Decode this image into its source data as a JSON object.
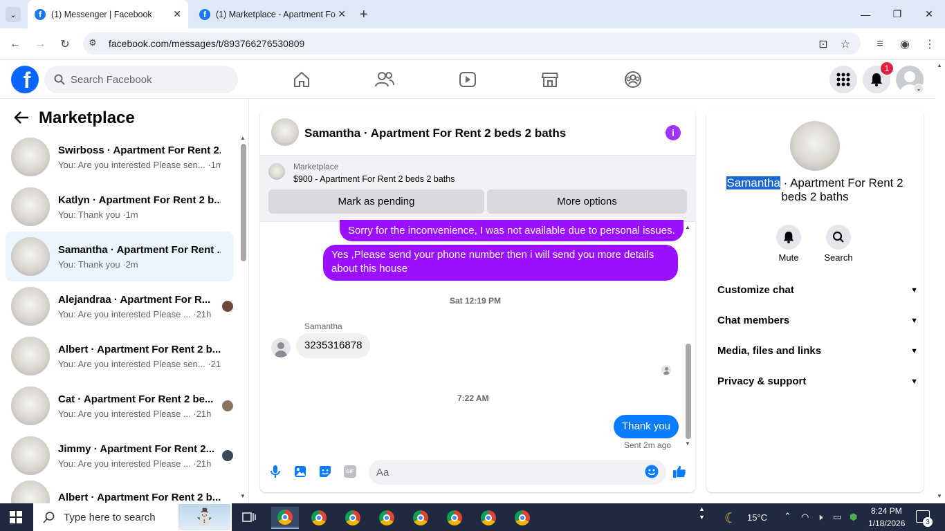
{
  "browser": {
    "tabs": [
      {
        "title": "(1) Messenger | Facebook"
      },
      {
        "title": "(1) Marketplace - Apartment Fo"
      }
    ],
    "url": "facebook.com/messages/t/893766276530809"
  },
  "header": {
    "search_placeholder": "Search Facebook",
    "notification_count": "1"
  },
  "sidebar": {
    "title": "Marketplace",
    "conversations": [
      {
        "name": "Swirboss · Apartment For Rent 2...",
        "preview": "You: Are you interested Please sen... ·1m"
      },
      {
        "name": "Katlyn · Apartment For Rent 2 b...",
        "preview": "You: Thank you ·1m"
      },
      {
        "name": "Samantha · Apartment For Rent ...",
        "preview": "You: Thank you ·2m"
      },
      {
        "name": "Alejandraa · Apartment For R...",
        "preview": "You: Are you interested Please ... ·21h"
      },
      {
        "name": "Albert · Apartment For Rent 2 b...",
        "preview": "You: Are you interested Please sen... ·21h"
      },
      {
        "name": "Cat · Apartment For Rent 2 be...",
        "preview": "You: Are you interested Please ... ·21h"
      },
      {
        "name": "Jimmy · Apartment For Rent 2...",
        "preview": "You: Are you interested Please ... ·21h"
      },
      {
        "name": "Albert · Apartment For Rent 2 b...",
        "preview": ""
      }
    ]
  },
  "chat": {
    "title": "Samantha · Apartment For Rent 2 beds 2 baths",
    "marketplace_label": "Marketplace",
    "listing": "$900 - Apartment For Rent 2 beds 2 baths",
    "mark_pending": "Mark as pending",
    "more_options": "More options",
    "messages": {
      "out1": "Sorry for the inconvenience, I was not available due to personal issues.",
      "out2": "Yes ,Please send your phone number then i will send you more details about this house",
      "ts1": "Sat 12:19 PM",
      "sender": "Samantha",
      "in1": "3235316878",
      "ts2": "7:22 AM",
      "out3": "Thank you",
      "sent_status": "Sent 2m ago"
    },
    "composer_placeholder": "Aa"
  },
  "details": {
    "name_highlight": "Samantha",
    "name_rest": " · Apartment For Rent 2 beds 2 baths",
    "mute": "Mute",
    "search": "Search",
    "rows": [
      "Customize chat",
      "Chat members",
      "Media, files and links",
      "Privacy & support"
    ]
  },
  "taskbar": {
    "search_placeholder": "Type here to search",
    "temperature": "15°C",
    "time": "8:24 PM",
    "date": "1/18/2026",
    "notif": "3"
  },
  "colors": {
    "accent": "#9b10ff",
    "facebook_blue": "#0866ff",
    "selected_row": "#ebf5ff"
  }
}
